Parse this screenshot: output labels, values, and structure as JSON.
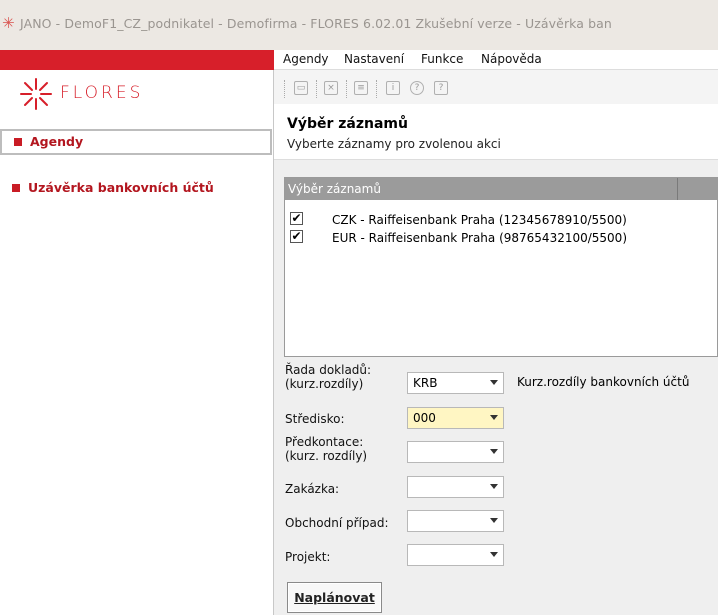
{
  "window": {
    "title": "JANO - DemoF1_CZ_podnikatel - Demofirma - FLORES 6.02.01 Zkušební verze - Uzávěrka ban"
  },
  "sidebar": {
    "logo_text": "FLORES",
    "items": [
      {
        "label": "Agendy"
      },
      {
        "label": "Uzávěrka bankovních účtů"
      }
    ]
  },
  "menu": {
    "items": [
      "Agendy",
      "Nastavení",
      "Funkce",
      "Nápověda"
    ]
  },
  "header": {
    "title": "Výběr záznamů",
    "subtitle": "Vyberte záznamy pro zvolenou akci"
  },
  "grid": {
    "column": "Výběr záznamů",
    "rows": [
      {
        "checked": true,
        "text": "CZK - Raiffeisenbank Praha (12345678910/5500)"
      },
      {
        "checked": true,
        "text": "EUR - Raiffeisenbank Praha (98765432100/5500)"
      }
    ]
  },
  "form": {
    "rada_label_1": "Řada dokladů:",
    "rada_label_2": "(kurz.rozdíly)",
    "rada_value": "KRB",
    "rada_desc": "Kurz.rozdíly bankovních účtů",
    "stredisko_label": "Středisko:",
    "stredisko_value": "000",
    "predkontace_label_1": "Předkontace:",
    "predkontace_label_2": "(kurz. rozdíly)",
    "zakazka_label": "Zakázka:",
    "obchodni_label": "Obchodní případ:",
    "projekt_label": "Projekt:"
  },
  "buttons": {
    "schedule": "Naplánovat"
  },
  "colors": {
    "brand_red": "#d71f2a",
    "highlight_yellow": "#fff6c3"
  }
}
